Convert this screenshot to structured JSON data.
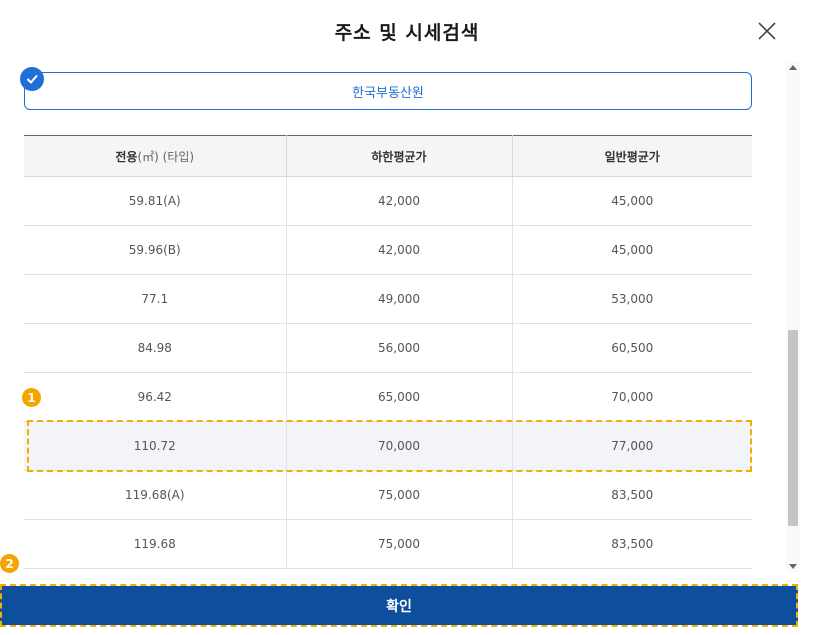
{
  "header": {
    "title": "주소 및 시세검색"
  },
  "source": {
    "label": "한국부동산원"
  },
  "table": {
    "columns": [
      "전용",
      "하한평균가",
      "일반평균가"
    ],
    "area_unit": "(㎡) (타입)",
    "rows": [
      [
        "59.81(A)",
        "42,000",
        "45,000"
      ],
      [
        "59.96(B)",
        "42,000",
        "45,000"
      ],
      [
        "77.1",
        "49,000",
        "53,000"
      ],
      [
        "84.98",
        "56,000",
        "60,500"
      ],
      [
        "96.42",
        "65,000",
        "70,000"
      ],
      [
        "110.72",
        "70,000",
        "77,000"
      ],
      [
        "119.68(A)",
        "75,000",
        "83,500"
      ],
      [
        "119.68",
        "75,000",
        "83,500"
      ]
    ]
  },
  "markers": {
    "first": "1",
    "second": "2"
  },
  "footer": {
    "confirm_label": "확인"
  },
  "colors": {
    "accent": "#1f6fd6",
    "confirm_bg": "#0d4f9c",
    "annotation": "#f0b000"
  },
  "icons": {
    "close": "close-icon",
    "check": "check-icon"
  }
}
